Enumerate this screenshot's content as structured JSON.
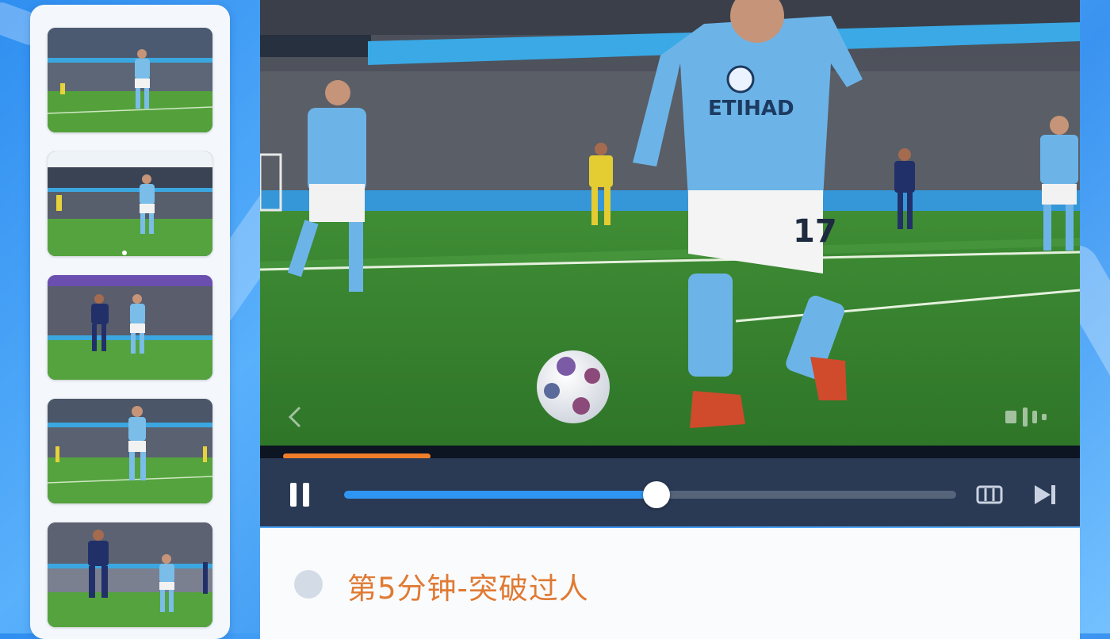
{
  "playlist": {
    "items": [
      {
        "id": "clip-1",
        "scene": "striker-running"
      },
      {
        "id": "clip-2",
        "scene": "striker-dribble"
      },
      {
        "id": "clip-3",
        "scene": "duel"
      },
      {
        "id": "clip-4",
        "scene": "striker-forward"
      },
      {
        "id": "clip-5",
        "scene": "duel-wide"
      }
    ]
  },
  "player": {
    "scene_kit_text": "ETIHAD",
    "shirt_number": "17",
    "progress_fraction": 0.51,
    "buffer_marker_fraction": 0.18,
    "controls": {
      "pause_icon": "pause-icon",
      "captions_icon": "captions-icon",
      "next_icon": "skip-next-icon"
    }
  },
  "caption": {
    "text": "第5分钟-突破过人"
  },
  "colors": {
    "accent_orange": "#e07a33",
    "progress_blue": "#2f95f3",
    "kit_sky_blue": "#6cb4e8",
    "control_bar": "#2a3a55"
  }
}
